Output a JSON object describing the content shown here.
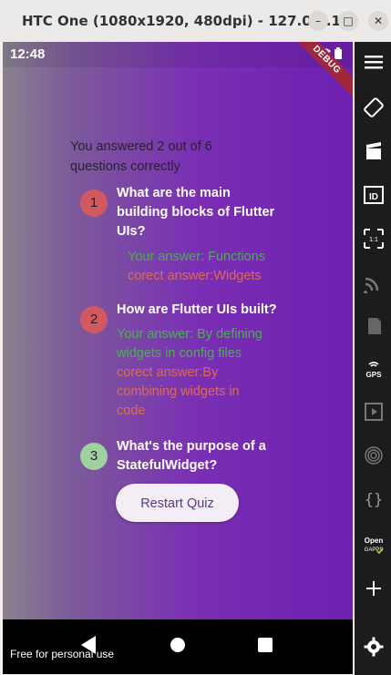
{
  "window": {
    "title": "HTC One (1080x1920, 480dpi) - 127.0.0.1...",
    "minimize_glyph": "–",
    "maximize_glyph": "□",
    "close_glyph": "✕"
  },
  "status_bar": {
    "time": "12:48",
    "icons": [
      "wifi-icon",
      "battery-icon"
    ],
    "debug_label": "DEBUG"
  },
  "summary": {
    "text": "You answered 2 out of 6 questions correctly"
  },
  "questions": [
    {
      "index": "1",
      "question": "What are the main building blocks of Flutter UIs?",
      "user_answer": "Your answer: Functions",
      "correct_answer": "corect answer:Widgets",
      "correct": false
    },
    {
      "index": "2",
      "question": " How are Flutter UIs built?",
      "user_answer": "Your answer: By defining widgets in config files",
      "correct_answer": "corect answer:By combining widgets in code",
      "correct": false
    },
    {
      "index": "3",
      "question": "What's the purpose of a StatefulWidget?",
      "correct": true
    }
  ],
  "restart_button": {
    "label": "Restart Quiz"
  },
  "watermark": "Free for personal use",
  "sidebar_tools": [
    {
      "name": "menu-icon"
    },
    {
      "name": "rotate-icon"
    },
    {
      "name": "screen-record-icon"
    },
    {
      "name": "id-icon",
      "label": "ID"
    },
    {
      "name": "pixel-perfect-icon",
      "label": "1:1"
    },
    {
      "name": "cast-icon"
    },
    {
      "name": "sd-card-icon"
    },
    {
      "name": "gps-icon",
      "label": "GPS"
    },
    {
      "name": "media-icon"
    },
    {
      "name": "fingerprint-icon"
    },
    {
      "name": "code-icon",
      "label": "{ }"
    },
    {
      "name": "opengapps-icon",
      "label": "Open GAPPS"
    },
    {
      "name": "add-icon",
      "label": "+"
    },
    {
      "name": "settings-icon"
    }
  ],
  "colors": {
    "correct_user_answer": "#4ab04f",
    "correct_answer": "#e06a4e",
    "wrong_badge": "#d05a60",
    "right_badge": "#9ed0a0",
    "gradient_end": "#6e1fb0"
  }
}
